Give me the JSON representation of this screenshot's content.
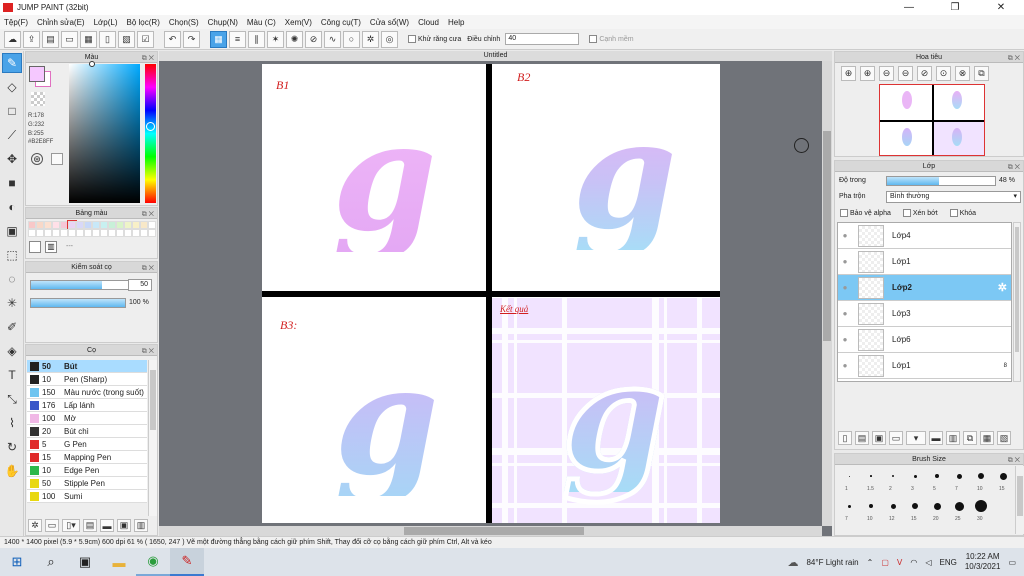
{
  "window": {
    "title": "JUMP PAINT (32bit)",
    "min": "—",
    "max": "❐",
    "close": "✕"
  },
  "menu": [
    "Tệp(F)",
    "Chỉnh sửa(E)",
    "Lớp(L)",
    "Bộ lọc(R)",
    "Chọn(S)",
    "Chụp(N)",
    "Màu (C)",
    "Xem(V)",
    "Công cụ(T)",
    "Cửa sổ(W)",
    "Cloud",
    "Help"
  ],
  "toolbar": {
    "antialias_label": "Khử răng cưa",
    "correction_label": "Điều chỉnh",
    "correction_value": "40",
    "snap_label": "Cạnh mềm"
  },
  "color_panel": {
    "title": "Màu",
    "r": "R:178",
    "g": "G:232",
    "b": "B:255",
    "hex": "#B2E8FF",
    "fg_color": "#f5c8ff",
    "bg_color": "#ffffff"
  },
  "swatch_panel": {
    "title": "Bảng màu",
    "extra": "---"
  },
  "control_panel": {
    "title": "Kiểm soát cọ",
    "size_value": "50",
    "opacity_value": "100 %"
  },
  "brush_panel": {
    "title": "Cọ",
    "items": [
      {
        "size": "50",
        "name": "Bút",
        "color": "#222222",
        "active": true
      },
      {
        "size": "10",
        "name": "Pen (Sharp)",
        "color": "#222222"
      },
      {
        "size": "150",
        "name": "Màu nước (trong suốt)",
        "color": "#6ec4f0"
      },
      {
        "size": "176",
        "name": "Lấp lánh",
        "color": "#3b58c8"
      },
      {
        "size": "100",
        "name": "Mờ",
        "color": "#f0b8e6"
      },
      {
        "size": "20",
        "name": "Bút chì",
        "color": "#333333"
      },
      {
        "size": "5",
        "name": "G Pen",
        "color": "#e02a2a"
      },
      {
        "size": "15",
        "name": "Mapping Pen",
        "color": "#e02a2a"
      },
      {
        "size": "10",
        "name": "Edge Pen",
        "color": "#2db84a"
      },
      {
        "size": "50",
        "name": "Stipple Pen",
        "color": "#e8d810"
      },
      {
        "size": "100",
        "name": "Sumi",
        "color": "#e8d810"
      }
    ]
  },
  "canvas": {
    "tab": "Untitled",
    "labels": {
      "q1": "B1",
      "q2": "B2",
      "q3": "B3:",
      "q4": "Kết quả"
    },
    "glyph": "g"
  },
  "navigator": {
    "title": "Hoa tiêu"
  },
  "layer_panel": {
    "title": "Lớp",
    "opacity_label": "Độ trong",
    "opacity_value": "48 %",
    "opacity_fraction": 0.48,
    "blend_label": "Pha trộn",
    "blend_value": "Bình thường",
    "protect_alpha": "Bảo vệ alpha",
    "clip": "Xén bớt",
    "lock": "Khóa",
    "layers": [
      {
        "name": "Lớp4"
      },
      {
        "name": "Lớp1"
      },
      {
        "name": "Lớp2",
        "active": true
      },
      {
        "name": "Lớp3"
      },
      {
        "name": "Lớp6"
      },
      {
        "name": "Lớp1",
        "badge": "8"
      }
    ]
  },
  "brush_size": {
    "title": "Brush Size",
    "row1": [
      "1",
      "1.5",
      "2",
      "3",
      "5",
      "7",
      "10",
      "15"
    ],
    "row2": [
      "7",
      "10",
      "12",
      "15",
      "20",
      "25",
      "30"
    ]
  },
  "status": {
    "text": "1400 * 1400 pixel    (5.9 * 5.9cm)    600 dpi    61 %    ( 1650, 247 )    Vẽ một đường thẳng bằng cách giữ phím Shift, Thay đổi cỡ cọ bằng cách giữ phím Ctrl, Alt và kéo"
  },
  "taskbar": {
    "weather": "84°F  Light rain",
    "lang": "ENG",
    "time": "10:22 AM",
    "date": "10/3/2021"
  }
}
